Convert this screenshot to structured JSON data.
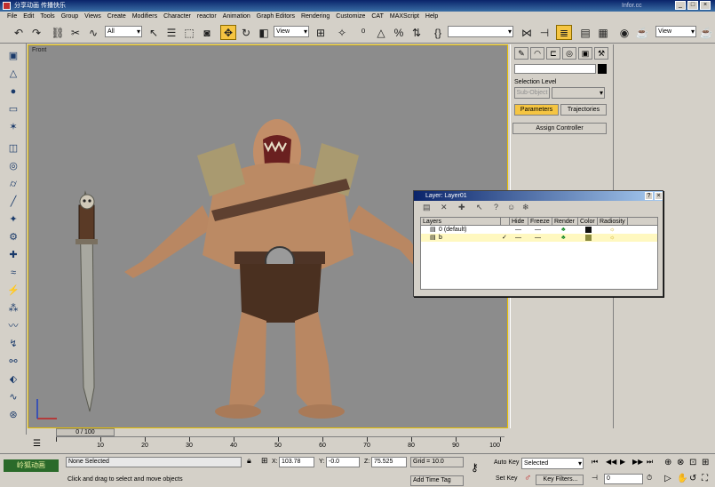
{
  "titlebar": {
    "title": "分享动画 传播快乐",
    "watermark": "Infor.cc"
  },
  "menu": [
    "File",
    "Edit",
    "Tools",
    "Group",
    "Views",
    "Create",
    "Modifiers",
    "Character",
    "reactor",
    "Animation",
    "Graph Editors",
    "Rendering",
    "Customize",
    "CAT",
    "MAXScript",
    "Help"
  ],
  "toolbar": {
    "selection_filter": "All",
    "ref_coord": "View",
    "ref_coord2": "View"
  },
  "viewport": {
    "label": "Front"
  },
  "command_panel": {
    "selection_level_label": "Selection Level",
    "sub_object_label": "Sub-Object",
    "parameters_button": "Parameters",
    "trajectories_button": "Trajectories",
    "assign_controller_label": "Assign Controller"
  },
  "layer_window": {
    "title": "Layer: Layer01",
    "columns": [
      "Layers",
      "Hide",
      "Freeze",
      "Render",
      "Color",
      "Radiosity"
    ],
    "rows": [
      {
        "name": "0 (default)",
        "hide": "—",
        "freeze": "—",
        "color": "#101010"
      },
      {
        "name": "b",
        "hide": "—",
        "freeze": "—",
        "color": "#8a8a40"
      }
    ]
  },
  "timeline": {
    "slider_label": "0 / 100",
    "ticks": [
      "10",
      "20",
      "30",
      "40",
      "50",
      "60",
      "70",
      "80",
      "90",
      "100"
    ]
  },
  "status": {
    "selection": "None Selected",
    "prompt": "Click and drag to select and move objects",
    "x_label": "X:",
    "x_value": "103.78",
    "y_label": "Y:",
    "y_value": "-0.0",
    "z_label": "Z:",
    "z_value": "75.525",
    "grid": "Grid = 10.0",
    "add_time_tag": "Add Time Tag",
    "auto_key": "Auto Key",
    "auto_key_mode": "Selected",
    "set_key": "Set Key",
    "key_filters": "Key Filters...",
    "frame": "0",
    "logo_text": "岭狐动画"
  }
}
